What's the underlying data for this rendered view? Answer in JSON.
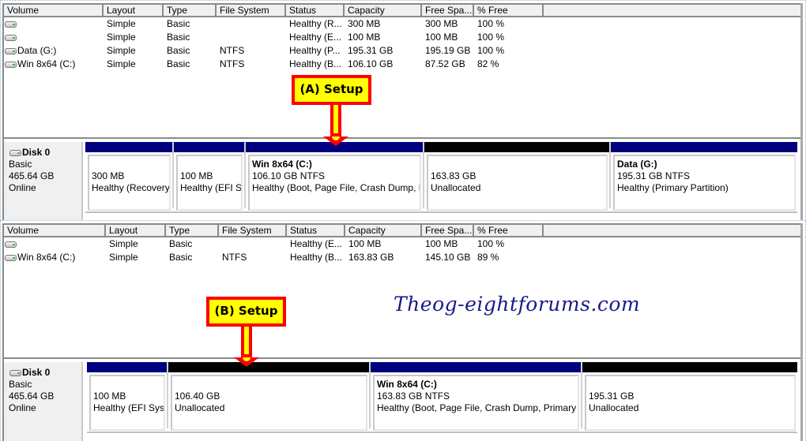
{
  "columns": [
    "Volume",
    "Layout",
    "Type",
    "File System",
    "Status",
    "Capacity",
    "Free Spa...",
    "% Free"
  ],
  "panel_a": {
    "callout": "(A) Setup",
    "volumes": [
      {
        "name": "",
        "layout": "Simple",
        "type": "Basic",
        "fs": "",
        "status": "Healthy (R...",
        "capacity": "300 MB",
        "free": "300 MB",
        "pct": "100 %"
      },
      {
        "name": "",
        "layout": "Simple",
        "type": "Basic",
        "fs": "",
        "status": "Healthy (E...",
        "capacity": "100 MB",
        "free": "100 MB",
        "pct": "100 %"
      },
      {
        "name": "Data (G:)",
        "layout": "Simple",
        "type": "Basic",
        "fs": "NTFS",
        "status": "Healthy (P...",
        "capacity": "195.31 GB",
        "free": "195.19 GB",
        "pct": "100 %"
      },
      {
        "name": "Win 8x64 (C:)",
        "layout": "Simple",
        "type": "Basic",
        "fs": "NTFS",
        "status": "Healthy (B...",
        "capacity": "106.10 GB",
        "free": "87.52 GB",
        "pct": "82 %"
      }
    ],
    "disk": {
      "name": "Disk 0",
      "type": "Basic",
      "size": "465.64 GB",
      "state": "Online"
    },
    "partitions": [
      {
        "kind": "primary",
        "title": "",
        "line1": "300 MB",
        "line2": "Healthy (Recovery"
      },
      {
        "kind": "primary",
        "title": "",
        "line1": "100 MB",
        "line2": "Healthy (EFI Sy"
      },
      {
        "kind": "primary",
        "title": "Win 8x64  (C:)",
        "line1": "106.10 GB NTFS",
        "line2": "Healthy (Boot, Page File, Crash Dump, P"
      },
      {
        "kind": "unalloc",
        "title": "",
        "line1": "163.83 GB",
        "line2": "Unallocated"
      },
      {
        "kind": "primary",
        "title": "Data  (G:)",
        "line1": "195.31 GB NTFS",
        "line2": "Healthy (Primary Partition)"
      }
    ]
  },
  "panel_b": {
    "callout": "(B) Setup",
    "volumes": [
      {
        "name": "",
        "layout": "Simple",
        "type": "Basic",
        "fs": "",
        "status": "Healthy (E...",
        "capacity": "100 MB",
        "free": "100 MB",
        "pct": "100 %"
      },
      {
        "name": "Win 8x64 (C:)",
        "layout": "Simple",
        "type": "Basic",
        "fs": "NTFS",
        "status": "Healthy (B...",
        "capacity": "163.83 GB",
        "free": "145.10 GB",
        "pct": "89 %"
      }
    ],
    "disk": {
      "name": "Disk 0",
      "type": "Basic",
      "size": "465.64 GB",
      "state": "Online"
    },
    "partitions": [
      {
        "kind": "primary",
        "title": "",
        "line1": "100 MB",
        "line2": "Healthy (EFI Syst"
      },
      {
        "kind": "unalloc",
        "title": "",
        "line1": "106.40 GB",
        "line2": "Unallocated"
      },
      {
        "kind": "primary",
        "title": "Win 8x64  (C:)",
        "line1": "163.83 GB NTFS",
        "line2": "Healthy (Boot, Page File, Crash Dump, Primary P"
      },
      {
        "kind": "unalloc",
        "title": "",
        "line1": "195.31 GB",
        "line2": "Unallocated"
      }
    ]
  },
  "watermark": "Theog-eightforums.com",
  "colors": {
    "primary_partition": "#00007f",
    "unallocated": "#000000",
    "callout_fill": "#ffff00",
    "callout_border": "#ff0000",
    "watermark": "#1a1a8a"
  }
}
